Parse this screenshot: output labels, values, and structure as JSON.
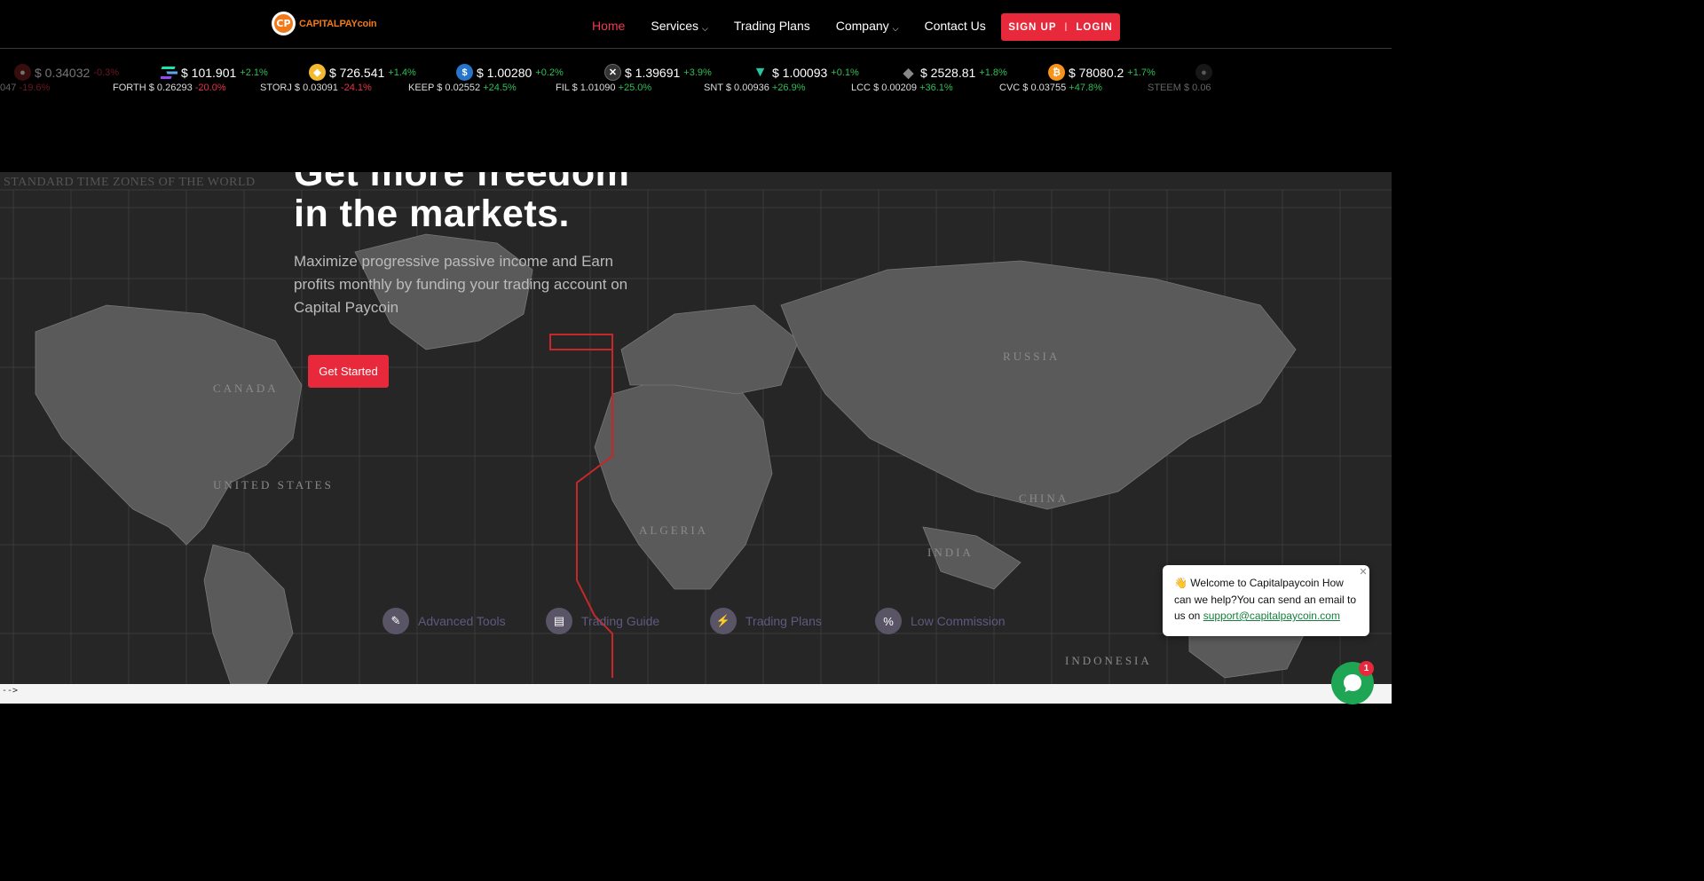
{
  "logo": {
    "mark": "CP",
    "text": "CAPITALPAYcoin"
  },
  "nav": {
    "items": [
      {
        "label": "Home",
        "active": true
      },
      {
        "label": "Services",
        "dropdown": true
      },
      {
        "label": "Trading Plans"
      },
      {
        "label": "Company",
        "dropdown": true
      },
      {
        "label": "Contact Us"
      }
    ],
    "signup": "SIGN UP",
    "separator": "|",
    "login": "LOGIN"
  },
  "ticker_row1": [
    {
      "icon": "coin-icon",
      "price": "$ 0.34032",
      "change": "-0.3%"
    },
    {
      "icon": "solana-icon",
      "price": "$ 101.901",
      "change": "+2.1%"
    },
    {
      "icon": "bnb-icon",
      "price": "$ 726.541",
      "change": "+1.4%"
    },
    {
      "icon": "usdc-icon",
      "price": "$ 1.00280",
      "change": "+0.2%"
    },
    {
      "icon": "xrp-icon",
      "price": "$ 1.39691",
      "change": "+3.9%"
    },
    {
      "icon": "tether-icon",
      "price": "$ 1.00093",
      "change": "+0.1%"
    },
    {
      "icon": "ethereum-icon",
      "price": "$ 2528.81",
      "change": "+1.8%"
    },
    {
      "icon": "bitcoin-icon",
      "price": "$ 78080.2",
      "change": "+1.7%"
    }
  ],
  "ticker_row2": [
    {
      "symbol": "",
      "price": "047",
      "change": "-19.6%"
    },
    {
      "symbol": "FORTH",
      "price": "$ 0.26293",
      "change": "-20.0%"
    },
    {
      "symbol": "STORJ",
      "price": "$ 0.03091",
      "change": "-24.1%"
    },
    {
      "symbol": "KEEP",
      "price": "$ 0.02552",
      "change": "+24.5%"
    },
    {
      "symbol": "FIL",
      "price": "$ 1.01090",
      "change": "+25.0%"
    },
    {
      "symbol": "SNT",
      "price": "$ 0.00936",
      "change": "+26.9%"
    },
    {
      "symbol": "LCC",
      "price": "$ 0.00209",
      "change": "+36.1%"
    },
    {
      "symbol": "CVC",
      "price": "$ 0.03755",
      "change": "+47.8%"
    },
    {
      "symbol": "STEEM",
      "price": "$ 0.06",
      "change": ""
    }
  ],
  "hero": {
    "map_title": "STANDARD TIME ZONES OF THE WORLD",
    "title_line1": "Get more freedom",
    "title_line2": "in the markets.",
    "subtitle": "Maximize progressive passive income and Earn profits monthly by funding your trading account on Capital Paycoin",
    "cta": "Get Started"
  },
  "features": [
    {
      "icon": "tools-icon",
      "label": "Advanced Tools"
    },
    {
      "icon": "document-icon",
      "label": "Trading Guide"
    },
    {
      "icon": "lightning-icon",
      "label": "Trading Plans"
    },
    {
      "icon": "percent-icon",
      "label": "Low Commission"
    }
  ],
  "footer_text": "-->",
  "chat": {
    "wave": "👋",
    "message": "Welcome to Capitalpaycoin How can we help?You can send an email to us on",
    "email": "support@capitalpaycoin.com",
    "badge": "1"
  }
}
